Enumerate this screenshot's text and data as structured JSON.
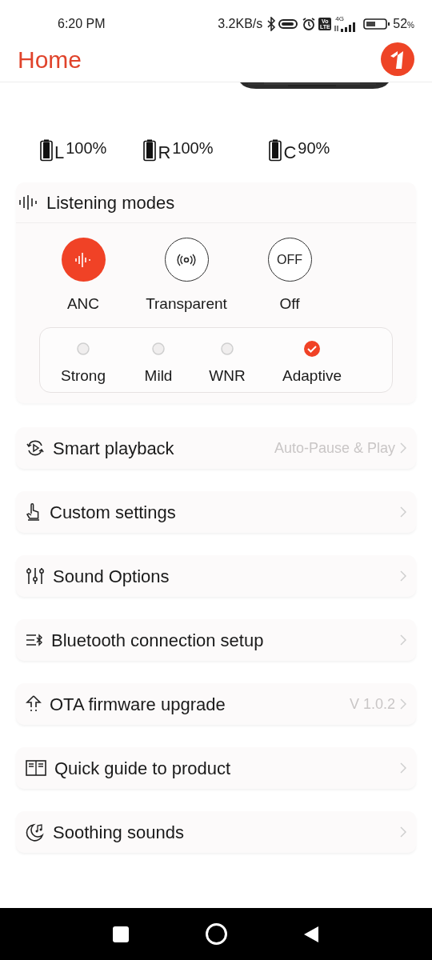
{
  "status_bar": {
    "time": "6:20 PM",
    "network_speed": "3.2KB/s",
    "volte": [
      "Vo",
      "LTE"
    ],
    "network_type": "4G",
    "battery_text": "52",
    "battery_unit": "%"
  },
  "header": {
    "title": "Home"
  },
  "earbuds_battery": [
    {
      "label": "L",
      "reading": "100%"
    },
    {
      "label": "R",
      "reading": "100%"
    },
    {
      "label": "C",
      "reading": "90%"
    }
  ],
  "listening_modes": {
    "title": "Listening modes",
    "modes": [
      {
        "kind": "anc",
        "label": "ANC",
        "selected": true
      },
      {
        "kind": "transparent",
        "label": "Transparent",
        "selected": false
      },
      {
        "kind": "off",
        "label": "Off",
        "icon_text": "OFF",
        "selected": false
      }
    ],
    "anc_levels": [
      {
        "label": "Strong",
        "selected": false
      },
      {
        "label": "Mild",
        "selected": false
      },
      {
        "label": "WNR",
        "selected": false
      },
      {
        "label": "Adaptive",
        "selected": true
      }
    ]
  },
  "menu": [
    {
      "kind": "playback",
      "label": "Smart playback",
      "value": "Auto-Pause & Play"
    },
    {
      "kind": "custom",
      "label": "Custom settings"
    },
    {
      "kind": "sound",
      "label": "Sound Options"
    },
    {
      "kind": "bluetooth",
      "label": "Bluetooth connection setup"
    },
    {
      "kind": "ota",
      "label": "OTA firmware upgrade",
      "value": "V 1.0.2"
    },
    {
      "kind": "guide",
      "label": "Quick guide to product"
    },
    {
      "kind": "sleep",
      "label": "Soothing sounds"
    }
  ]
}
